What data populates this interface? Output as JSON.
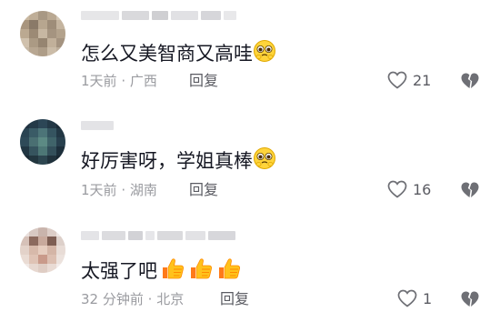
{
  "comments": [
    {
      "text": "怎么又美智商又高哇",
      "emoji": "crying-face-emoji",
      "time": "1天前",
      "location": "广西",
      "reply_label": "回复",
      "likes": "21"
    },
    {
      "text": "好厉害呀，学姐真棒",
      "emoji": "crying-face-emoji",
      "time": "1天前",
      "location": "湖南",
      "reply_label": "回复",
      "likes": "16"
    },
    {
      "text": "太强了吧",
      "emoji": "thumbs-up-emoji",
      "time": "32 分钟前",
      "location": "北京",
      "reply_label": "回复",
      "likes": "1"
    }
  ],
  "meta_separator": "·",
  "colors": {
    "text": "#161823",
    "meta": "#9a9ba0",
    "action": "#5a5b62"
  }
}
